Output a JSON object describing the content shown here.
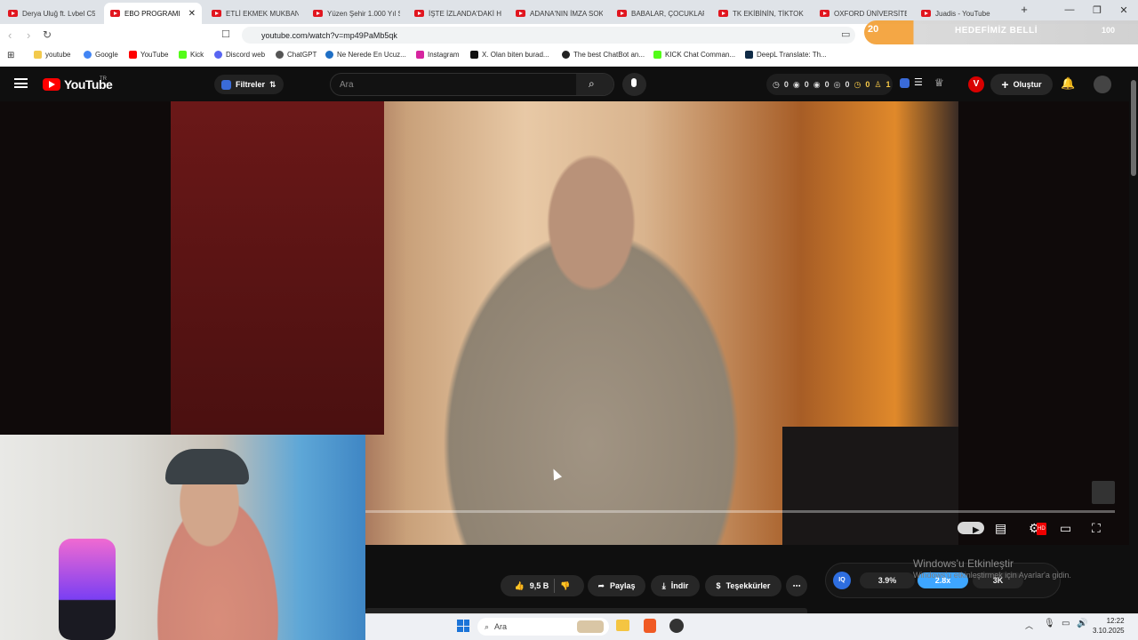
{
  "browser": {
    "tabs": [
      {
        "label": "Derya Uluğ ft. Lvbel C5",
        "active": false
      },
      {
        "label": "EBO PROGRAMI İLE",
        "active": true
      },
      {
        "label": "ETLİ EKMEK MUKBANG",
        "active": false
      },
      {
        "label": "Yüzen Şehir 1.000 Yıl S",
        "active": false
      },
      {
        "label": "İŞTE İZLANDA'DAKİ HA",
        "active": false
      },
      {
        "label": "ADANA'NIN İMZA SOK",
        "active": false
      },
      {
        "label": "BABALAR, ÇOCUKLAR",
        "active": false
      },
      {
        "label": "TK EKİBİNİN, TİKTOK V",
        "active": false
      },
      {
        "label": "OXFORD ÜNİVERSİTES",
        "active": false
      },
      {
        "label": "Juadis - YouTube",
        "active": false
      }
    ],
    "new_tab": "+",
    "url": "youtube.com/watch?v=mp49PaMb5qk",
    "bookmarks": [
      "youtube",
      "Google",
      "YouTube",
      "Kick",
      "Discord web",
      "ChatGPT",
      "Ne Nerede En Ucuz...",
      "Instagram",
      "X. Olan biten burad...",
      "The best ChatBot an...",
      "KICK Chat Comman...",
      "DeepL Translate: Th..."
    ],
    "extension": {
      "badge": "20",
      "label": "HEDEFİMİZ BELLİ",
      "count": "100"
    }
  },
  "youtube": {
    "logo": "YouTube",
    "country": "TR",
    "filters": "Filtreler",
    "search_placeholder": "Ara",
    "stats": [
      "0",
      "0",
      "0",
      "0",
      "0",
      "1"
    ],
    "avatar_letter": "V",
    "create": "Oluştur",
    "actions": {
      "likes": "9,5 B",
      "share": "Paylaş",
      "download": "İndir",
      "thanks": "Teşekkürler"
    },
    "speed": {
      "ext_icon": "IQ",
      "percent": "3.9%",
      "rate": "2.8x",
      "quality": "3K"
    },
    "watermark": {
      "title": "Windows'u Etkinleştir",
      "subtitle": "Windows'u etkinleştirmek için Ayarlar'a gidin."
    }
  },
  "taskbar": {
    "search": "Ara",
    "time": "12:22",
    "date": "3.10.2025"
  },
  "colors": {
    "yt_red": "#ff0000",
    "accent_blue": "#3ea6ff",
    "extension_orange": "#f4a33c"
  }
}
